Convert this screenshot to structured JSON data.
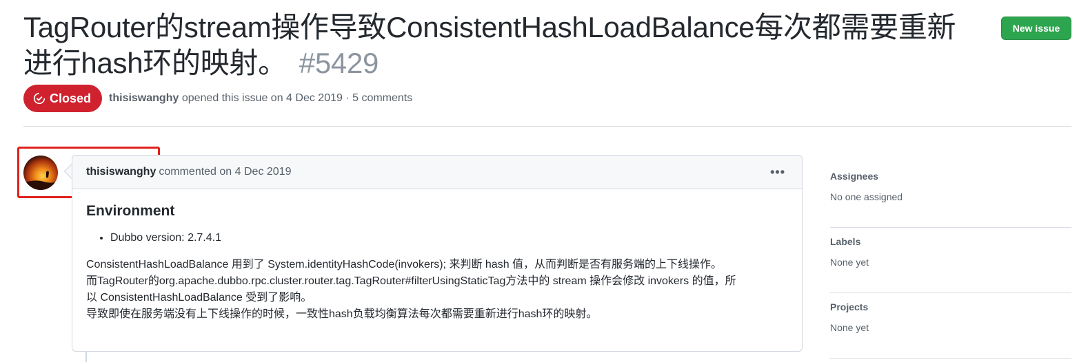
{
  "issue": {
    "title": "TagRouter的stream操作导致ConsistentHashLoadBalance每次都需要重新进行hash环的映射。",
    "number": "#5429",
    "state": "Closed",
    "author": "thisiswanghy",
    "meta_text": "opened this issue on 4 Dec 2019 · 5 comments"
  },
  "header": {
    "new_issue_label": "New issue"
  },
  "comment": {
    "author": "thisiswanghy",
    "meta": "commented on 4 Dec 2019",
    "menu_icon": "kebab-horizontal-icon",
    "heading": "Environment",
    "bullets": [
      "Dubbo version: 2.7.4.1"
    ],
    "paragraph_lines": [
      "ConsistentHashLoadBalance 用到了 System.identityHashCode(invokers); 来判断 hash 值，从而判断是否有服务端的上下线操作。",
      "而TagRouter的org.apache.dubbo.rpc.cluster.router.tag.TagRouter#filterUsingStaticTag方法中的 stream 操作会修改 invokers 的值，所",
      "以 ConsistentHashLoadBalance 受到了影响。",
      "导致即使在服务端没有上下线操作的时候，一致性hash负载均衡算法每次都需要重新进行hash环的映射。"
    ]
  },
  "sidebar": {
    "sections": [
      {
        "title": "Assignees",
        "value": "No one assigned"
      },
      {
        "title": "Labels",
        "value": "None yet"
      },
      {
        "title": "Projects",
        "value": "None yet"
      }
    ]
  },
  "colors": {
    "closed": "#cf222e",
    "new_issue": "#2da44e",
    "highlight": "#e0201b"
  }
}
